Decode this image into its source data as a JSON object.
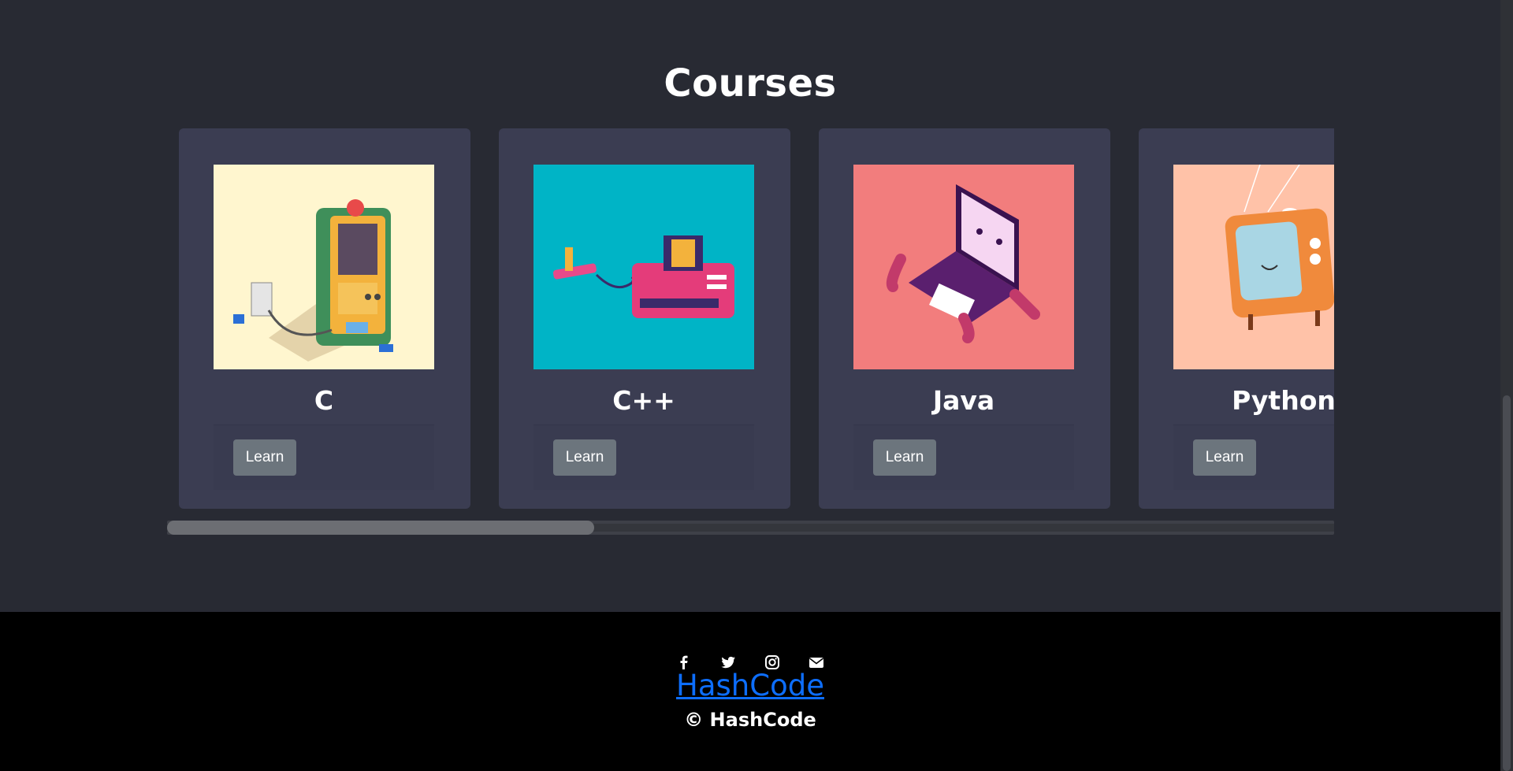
{
  "section": {
    "title": "Courses"
  },
  "courses": [
    {
      "name": "C",
      "button": "Learn",
      "image_bg": "#fff6cf",
      "image_icon": "arcade-machine-illustration"
    },
    {
      "name": "C++",
      "button": "Learn",
      "image_bg": "#00b4c6",
      "image_icon": "retro-game-console-illustration"
    },
    {
      "name": "Java",
      "button": "Learn",
      "image_bg": "#f27d7d",
      "image_icon": "laptop-character-illustration"
    },
    {
      "name": "Python",
      "button": "Learn",
      "image_bg": "#ffc2a8",
      "image_icon": "retro-tv-illustration"
    }
  ],
  "footer": {
    "social_icons": [
      "facebook-icon",
      "twitter-icon",
      "instagram-icon",
      "envelope-icon"
    ],
    "brand": "HashCode",
    "copyright": "© HashCode"
  },
  "colors": {
    "page_bg": "#282a33",
    "card_bg": "#3b3d52",
    "button_bg": "#6c757d",
    "link": "#0d6efd",
    "footer_bg": "#000000"
  }
}
